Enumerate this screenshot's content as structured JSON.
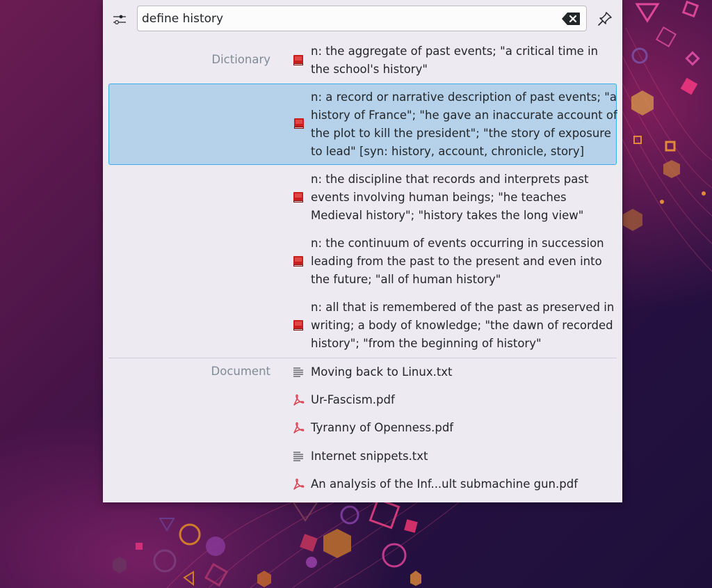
{
  "search": {
    "query": "define history"
  },
  "categories": {
    "dictionary": "Dictionary",
    "document": "Document"
  },
  "dictionary_results": [
    {
      "text": "n: the aggregate of past events; \"a critical time in the school's history\"",
      "icon": "dictionary-book-icon"
    },
    {
      "text": "n: a record or narrative description of past events; \"a history of France\"; \"he gave an inaccurate account of the plot to kill the president\"; \"the story of exposure to lead\" [syn: history, account, chronicle, story]",
      "icon": "dictionary-book-icon",
      "selected": true
    },
    {
      "text": "n: the discipline that records and interprets past events involving human beings; \"he teaches Medieval history\"; \"history takes the long view\"",
      "icon": "dictionary-book-icon"
    },
    {
      "text": "n: the continuum of events occurring in succession leading from the past to the present and even into the future; \"all of human history\"",
      "icon": "dictionary-book-icon"
    },
    {
      "text": "n: all that is remembered of the past as preserved in writing; a body of knowledge; \"the dawn of recorded history\"; \"from the beginning of history\"",
      "icon": "dictionary-book-icon"
    }
  ],
  "document_results": [
    {
      "text": "Moving back to Linux.txt",
      "icon": "text-file-icon"
    },
    {
      "text": "Ur-Fascism.pdf",
      "icon": "pdf-file-icon"
    },
    {
      "text": "Tyranny of Openness.pdf",
      "icon": "pdf-file-icon"
    },
    {
      "text": "Internet snippets.txt",
      "icon": "text-file-icon"
    },
    {
      "text": "An analysis of the Inf...ult submachine gun.pdf",
      "icon": "pdf-file-icon"
    }
  ],
  "colors": {
    "selection": "#b5d2ea",
    "selection_border": "#3daee9",
    "panel": "#eeeaf1",
    "category_text": "#7f8c95",
    "pdf_red": "#da4453"
  }
}
